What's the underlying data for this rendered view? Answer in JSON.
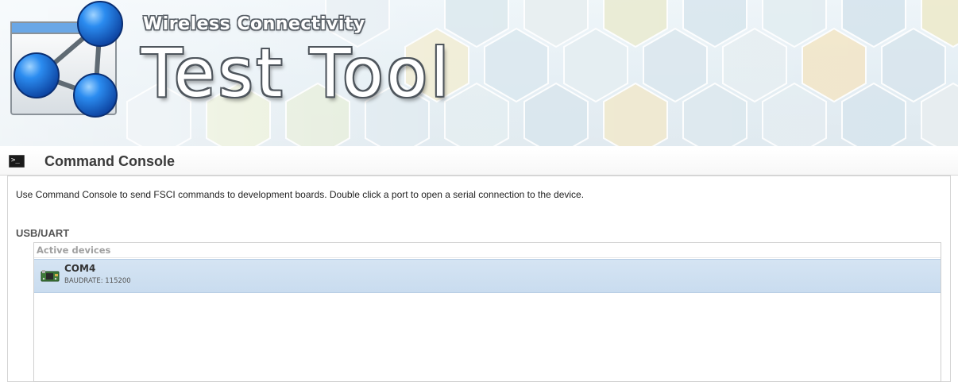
{
  "banner": {
    "product_line": "Wireless Connectivity",
    "app_title": "Test Tool",
    "logo_icon": "network-nodes-icon"
  },
  "section": {
    "title": "Command Console",
    "icon": "console-icon",
    "description": "Use Command Console to send FSCI commands to development boards. Double click a port to open a serial connection to the device."
  },
  "devices": {
    "group_label": "USB/UART",
    "list_header": "Active devices",
    "items": [
      {
        "name": "COM4",
        "baudrate_label": "BAUDRATE:",
        "baudrate_value": "115200",
        "icon": "dev-board-icon",
        "selected": true
      }
    ]
  },
  "colors": {
    "selection_bg": "#cfe0f1",
    "logo_blue": "#1a73e8",
    "title_outline": "#4f565d"
  }
}
